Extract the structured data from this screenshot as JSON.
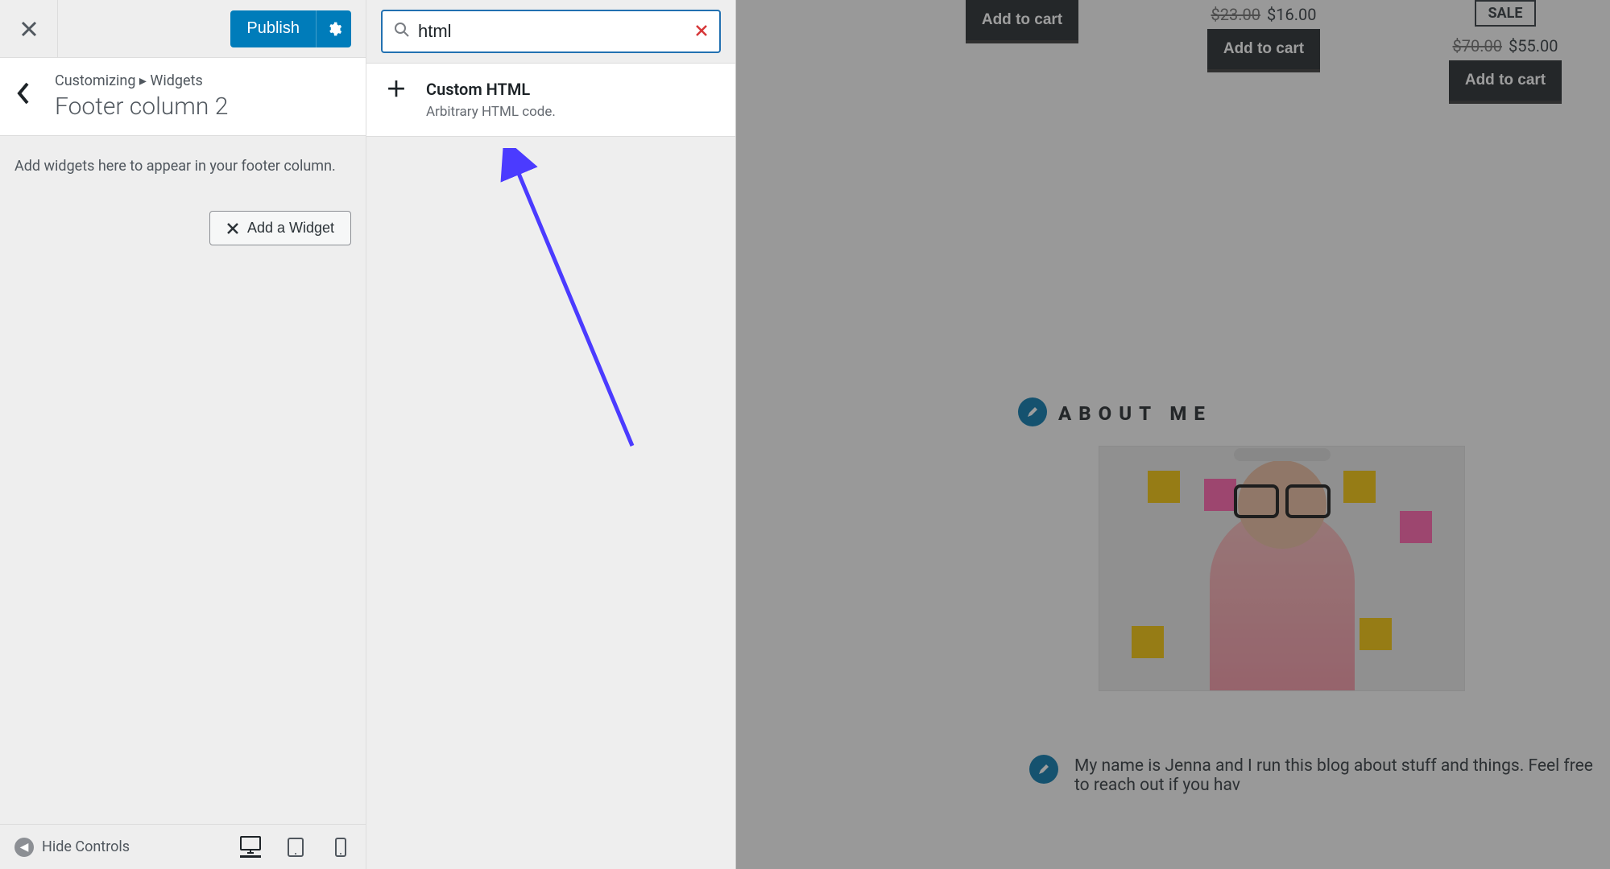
{
  "header": {
    "publish_label": "Publish"
  },
  "breadcrumb": {
    "top_a": "Customizing",
    "sep": "▸",
    "top_b": "Widgets",
    "title": "Footer column 2"
  },
  "panel": {
    "desc": "Add widgets here to appear in your footer column.",
    "add_widget_label": "Add a Widget"
  },
  "footer": {
    "hide_controls": "Hide Controls"
  },
  "search": {
    "value": "html"
  },
  "result": {
    "title": "Custom HTML",
    "desc": "Arbitrary HTML code."
  },
  "preview": {
    "sale_badge": "SALE",
    "cart": "Add to cart",
    "p1_old": "$23.00",
    "p1_new": "$16.00",
    "p2_old": "$70.00",
    "p2_new": "$55.00",
    "about_head": "ABOUT ME",
    "about_text": "My name is Jenna and I run this blog about stuff and things. Feel free to reach out if you hav"
  }
}
